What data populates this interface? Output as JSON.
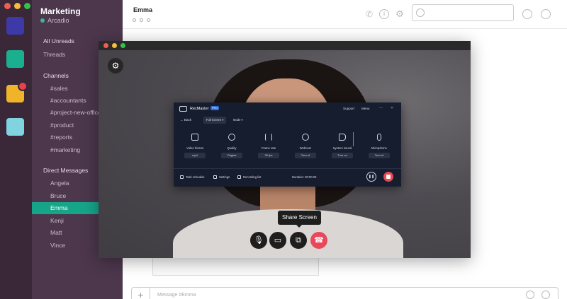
{
  "rail": {
    "workspaces": [
      {
        "color": "#3d3aa8"
      },
      {
        "color": "#1aaf8f"
      },
      {
        "color": "#f0b428",
        "badge": true
      },
      {
        "color": "#7fd4e0"
      }
    ]
  },
  "sidebar": {
    "team_name": "Marketing",
    "user_name": "Arcadio",
    "all_unreads": "All Unreads",
    "threads": "Threads",
    "channels_header": "Channels",
    "channels": [
      "#sales",
      "#accountants",
      "#project-new-office",
      "#product",
      "#reports",
      "#marketing"
    ],
    "dm_header": "Direct Messages",
    "direct_messages": [
      "Angela",
      "Bruce",
      "Emma",
      "Kenji",
      "Matt",
      "Vince"
    ],
    "active_dm": "Emma"
  },
  "main": {
    "chat_title": "Emma",
    "composer_placeholder": "Message #Emma"
  },
  "call": {
    "tooltip": "Share Screen"
  },
  "recmaster": {
    "app_name": "RecMaster",
    "badge": "PRO",
    "support": "Support",
    "menu": "Menu",
    "back": "Back",
    "mode_select": "Full Screen",
    "mode_label": "Mode",
    "options": [
      {
        "label": "Video format",
        "value": "mp4"
      },
      {
        "label": "Quality",
        "value": "Origina"
      },
      {
        "label": "Frame rate",
        "value": "30 fps"
      },
      {
        "label": "Webcam",
        "value": "Turn of"
      },
      {
        "label": "System sound",
        "value": "Turn on"
      },
      {
        "label": "Microphone",
        "value": "Turn of"
      }
    ],
    "task_schedule": "Task schedule",
    "settings": "Settings",
    "recording_list": "Recording list",
    "duration": "Duration: 00:00:25"
  },
  "colors": {
    "sidebar_bg": "#4c374c",
    "rail_bg": "#3a2738",
    "active_item": "#17a589",
    "end_call": "#e9485a",
    "stop_record": "#e84a53"
  }
}
